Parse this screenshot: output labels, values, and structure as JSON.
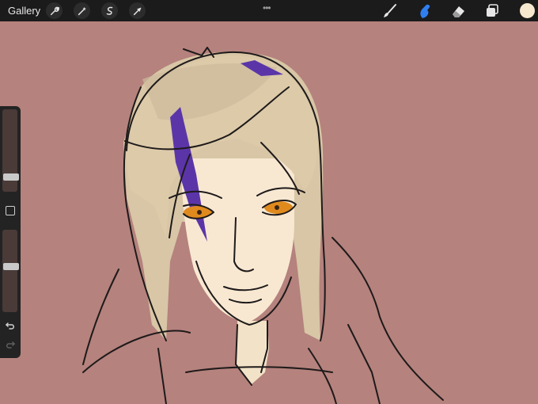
{
  "toolbar": {
    "gallery_label": "Gallery",
    "left_tools": [
      "wrench-icon",
      "magic-wand-icon",
      "selection-icon",
      "transform-arrow-icon"
    ],
    "right_tools": [
      "brush-icon",
      "smudge-icon",
      "eraser-icon",
      "layers-icon"
    ],
    "active_tool": "smudge-icon",
    "current_color": "#f6e7cf",
    "accent_color": "#2f7ff0"
  },
  "sidebar": {
    "brush_size_level": 0.15,
    "opacity_level": 0.56,
    "items": [
      "modify-button",
      "undo-icon",
      "redo-icon"
    ]
  },
  "canvas": {
    "background_color": "#b5827d"
  }
}
